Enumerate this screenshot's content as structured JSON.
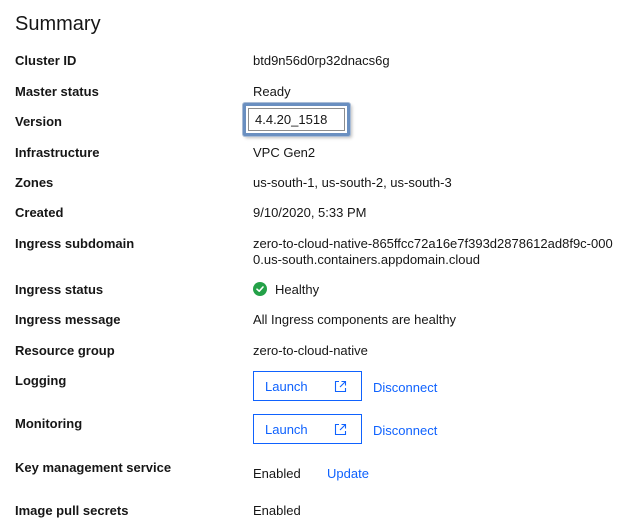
{
  "summary": {
    "title": "Summary",
    "rows": {
      "cluster_id": {
        "label": "Cluster ID",
        "value": "btd9n56d0rp32dnacs6g"
      },
      "master_status": {
        "label": "Master status",
        "value": "Ready"
      },
      "version": {
        "label": "Version",
        "value": "4.4.20_1518"
      },
      "infrastructure": {
        "label": "Infrastructure",
        "value": "VPC Gen2"
      },
      "zones": {
        "label": "Zones",
        "value": "us-south-1, us-south-2, us-south-3"
      },
      "created": {
        "label": "Created",
        "value": "9/10/2020, 5:33 PM"
      },
      "ingress_subdomain": {
        "label": "Ingress subdomain",
        "value_line1": "zero-to-cloud-native-865ffcc72a16e7f393d2878612ad8f9c-000",
        "value_line2": "0.us-south.containers.appdomain.cloud"
      },
      "ingress_status": {
        "label": "Ingress status",
        "value": "Healthy",
        "status_color": "#24a148",
        "icon": "checkmark-filled-icon"
      },
      "ingress_message": {
        "label": "Ingress message",
        "value": "All Ingress components are healthy"
      },
      "resource_group": {
        "label": "Resource group",
        "value": "zero-to-cloud-native"
      },
      "logging": {
        "label": "Logging",
        "launch_label": "Launch",
        "disconnect_label": "Disconnect",
        "icon": "launch-icon"
      },
      "monitoring": {
        "label": "Monitoring",
        "launch_label": "Launch",
        "disconnect_label": "Disconnect",
        "icon": "launch-icon"
      },
      "kms": {
        "label": "Key management service",
        "value": "Enabled",
        "update_label": "Update"
      },
      "image_pull_secrets": {
        "label": "Image pull secrets",
        "value": "Enabled"
      }
    }
  },
  "colors": {
    "link": "#0f62fe",
    "success": "#24a148",
    "highlight_border": "#6a8fc0"
  }
}
